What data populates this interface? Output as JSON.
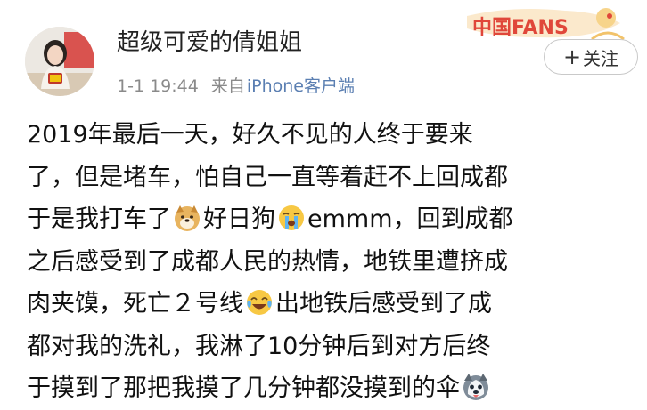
{
  "post": {
    "author": {
      "name": "超级可爱的倩姐姐"
    },
    "timestamp": "1-1 19:44",
    "source_label": "来自",
    "source_device": "iPhone客户端",
    "badge_text": "中国FANS",
    "follow_button": {
      "plus": "+",
      "label": "关注"
    },
    "lines": [
      {
        "segments": [
          {
            "type": "text",
            "text": "2019年最后一天，好久不见的人终于要来"
          }
        ]
      },
      {
        "segments": [
          {
            "type": "text",
            "text": "了，但是堵车，怕自己一直等着赶不上回成都"
          }
        ]
      },
      {
        "segments": [
          {
            "type": "text",
            "text": "于是我打车了"
          },
          {
            "type": "emoji",
            "icon": "doge-emoji"
          },
          {
            "type": "text",
            "text": "好日狗"
          },
          {
            "type": "emoji",
            "icon": "crying-face-emoji"
          },
          {
            "type": "text",
            "text": "emmm，回到成都"
          }
        ]
      },
      {
        "segments": [
          {
            "type": "text",
            "text": "之后感受到了成都人民的热情，地铁里遭挤成"
          }
        ]
      },
      {
        "segments": [
          {
            "type": "text",
            "text": "肉夹馍，死亡２号线"
          },
          {
            "type": "emoji",
            "icon": "laughing-tears-emoji"
          },
          {
            "type": "text",
            "text": "出地铁后感受到了成"
          }
        ]
      },
      {
        "segments": [
          {
            "type": "text",
            "text": "都对我的洗礼，我淋了10分钟后到对方后终"
          }
        ]
      },
      {
        "segments": [
          {
            "type": "text",
            "text": "于摸到了那把我摸了几分钟都没摸到的伞"
          },
          {
            "type": "emoji",
            "icon": "husky-emoji"
          }
        ]
      }
    ]
  },
  "colors": {
    "text": "#111111",
    "name": "#222222",
    "meta": "#8a8a8a",
    "source_link": "#5b7fb2",
    "badge_red": "#e0473a",
    "badge_gold": "#f2c36b"
  }
}
